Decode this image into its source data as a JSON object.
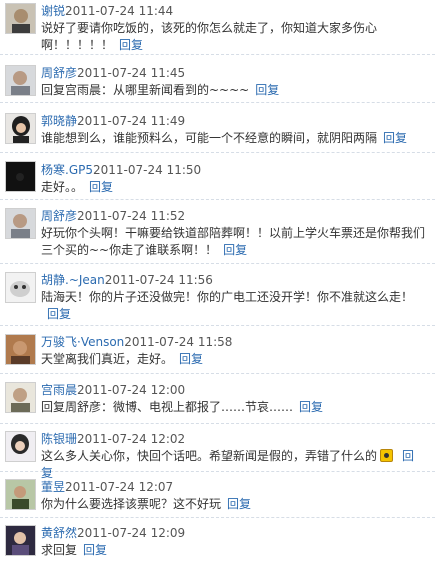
{
  "comments": [
    {
      "user": "谢锐",
      "time": "2011-07-24 11:44",
      "text": "说好了要请你吃饭的，该死的你怎么就走了，你知道大家多伤心啊！！！！！",
      "reply": "回复"
    },
    {
      "user": "周舒彦",
      "time": "2011-07-24 11:45",
      "text": "回复宫雨晨：从哪里新闻看到的~~~~",
      "reply": "回复"
    },
    {
      "user": "郭晓静",
      "time": "2011-07-24 11:49",
      "text": "谁能想到么，谁能预料么，可能一个不经意的瞬间，就阴阳两隔",
      "reply": "回复"
    },
    {
      "user": "杨寒.GP5",
      "time": "2011-07-24 11:50",
      "text": "走好。。",
      "reply": "回复"
    },
    {
      "user": "周舒彦",
      "time": "2011-07-24 11:52",
      "text": "好玩你个头啊！干嘛要给铁道部陪葬啊！！以前上学火车票还是你帮我们三个买的~~你走了谁联系啊！！",
      "reply": "回复"
    },
    {
      "user": "胡静.~Jean",
      "time": "2011-07-24 11:56",
      "text": "陆海天！你的片子还没做完！你的广电工还没开学！你不准就这么走！",
      "reply": "回复"
    },
    {
      "user": "万骏飞·Venson",
      "time": "2011-07-24 11:58",
      "text": "天堂离我们真近，走好。",
      "reply": "回复"
    },
    {
      "user": "宫雨晨",
      "time": "2011-07-24 12:00",
      "text": "回复周舒彦：微博、电视上都报了……节哀……",
      "reply": "回复"
    },
    {
      "user": "陈银珊",
      "time": "2011-07-24 12:02",
      "text": "这么多人关心你，快回个话吧。希望新闻是假的，弄错了什么的",
      "emoticon": "crying-emoticon",
      "reply": "回复"
    },
    {
      "user": "董昱",
      "time": "2011-07-24 12:07",
      "text": "你为什么要选择该票呢？这不好玩",
      "reply": "回复"
    },
    {
      "user": "黄舒然",
      "time": "2011-07-24 12:09",
      "text": "求回复",
      "reply": "回复"
    }
  ]
}
